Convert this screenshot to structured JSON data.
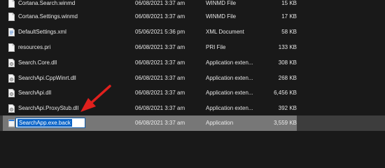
{
  "files": [
    {
      "name": "Cortana.Search.winmd",
      "date": "06/08/2021 3:37 am",
      "type": "WINMD File",
      "size": "15 KB",
      "icon": "file-icon"
    },
    {
      "name": "Cortana.Settings.winmd",
      "date": "06/08/2021 3:37 am",
      "type": "WINMD File",
      "size": "17 KB",
      "icon": "file-icon"
    },
    {
      "name": "DefaultSettings.xml",
      "date": "05/06/2021 5:36 pm",
      "type": "XML Document",
      "size": "58 KB",
      "icon": "xml-file-icon"
    },
    {
      "name": "resources.pri",
      "date": "06/08/2021 3:37 am",
      "type": "PRI File",
      "size": "133 KB",
      "icon": "file-icon"
    },
    {
      "name": "Search.Core.dll",
      "date": "06/08/2021 3:37 am",
      "type": "Application exten...",
      "size": "308 KB",
      "icon": "dll-file-icon"
    },
    {
      "name": "SearchApi.CppWinrt.dll",
      "date": "06/08/2021 3:37 am",
      "type": "Application exten...",
      "size": "268 KB",
      "icon": "dll-file-icon"
    },
    {
      "name": "SearchApi.dll",
      "date": "06/08/2021 3:37 am",
      "type": "Application exten...",
      "size": "6,456 KB",
      "icon": "dll-file-icon"
    },
    {
      "name": "SearchApi.ProxyStub.dll",
      "date": "06/08/2021 3:37 am",
      "type": "Application exten...",
      "size": "392 KB",
      "icon": "dll-file-icon"
    }
  ],
  "selected_file": {
    "name": "SearchApp.exe.back",
    "date": "06/08/2021 3:37 am",
    "type": "Application",
    "size": "3,559 KB",
    "icon": "application-icon"
  },
  "colors": {
    "background": "#191919",
    "selected_row": "#777777",
    "rename_highlight": "#0a64c8",
    "annotation_arrow": "#e0201d"
  }
}
